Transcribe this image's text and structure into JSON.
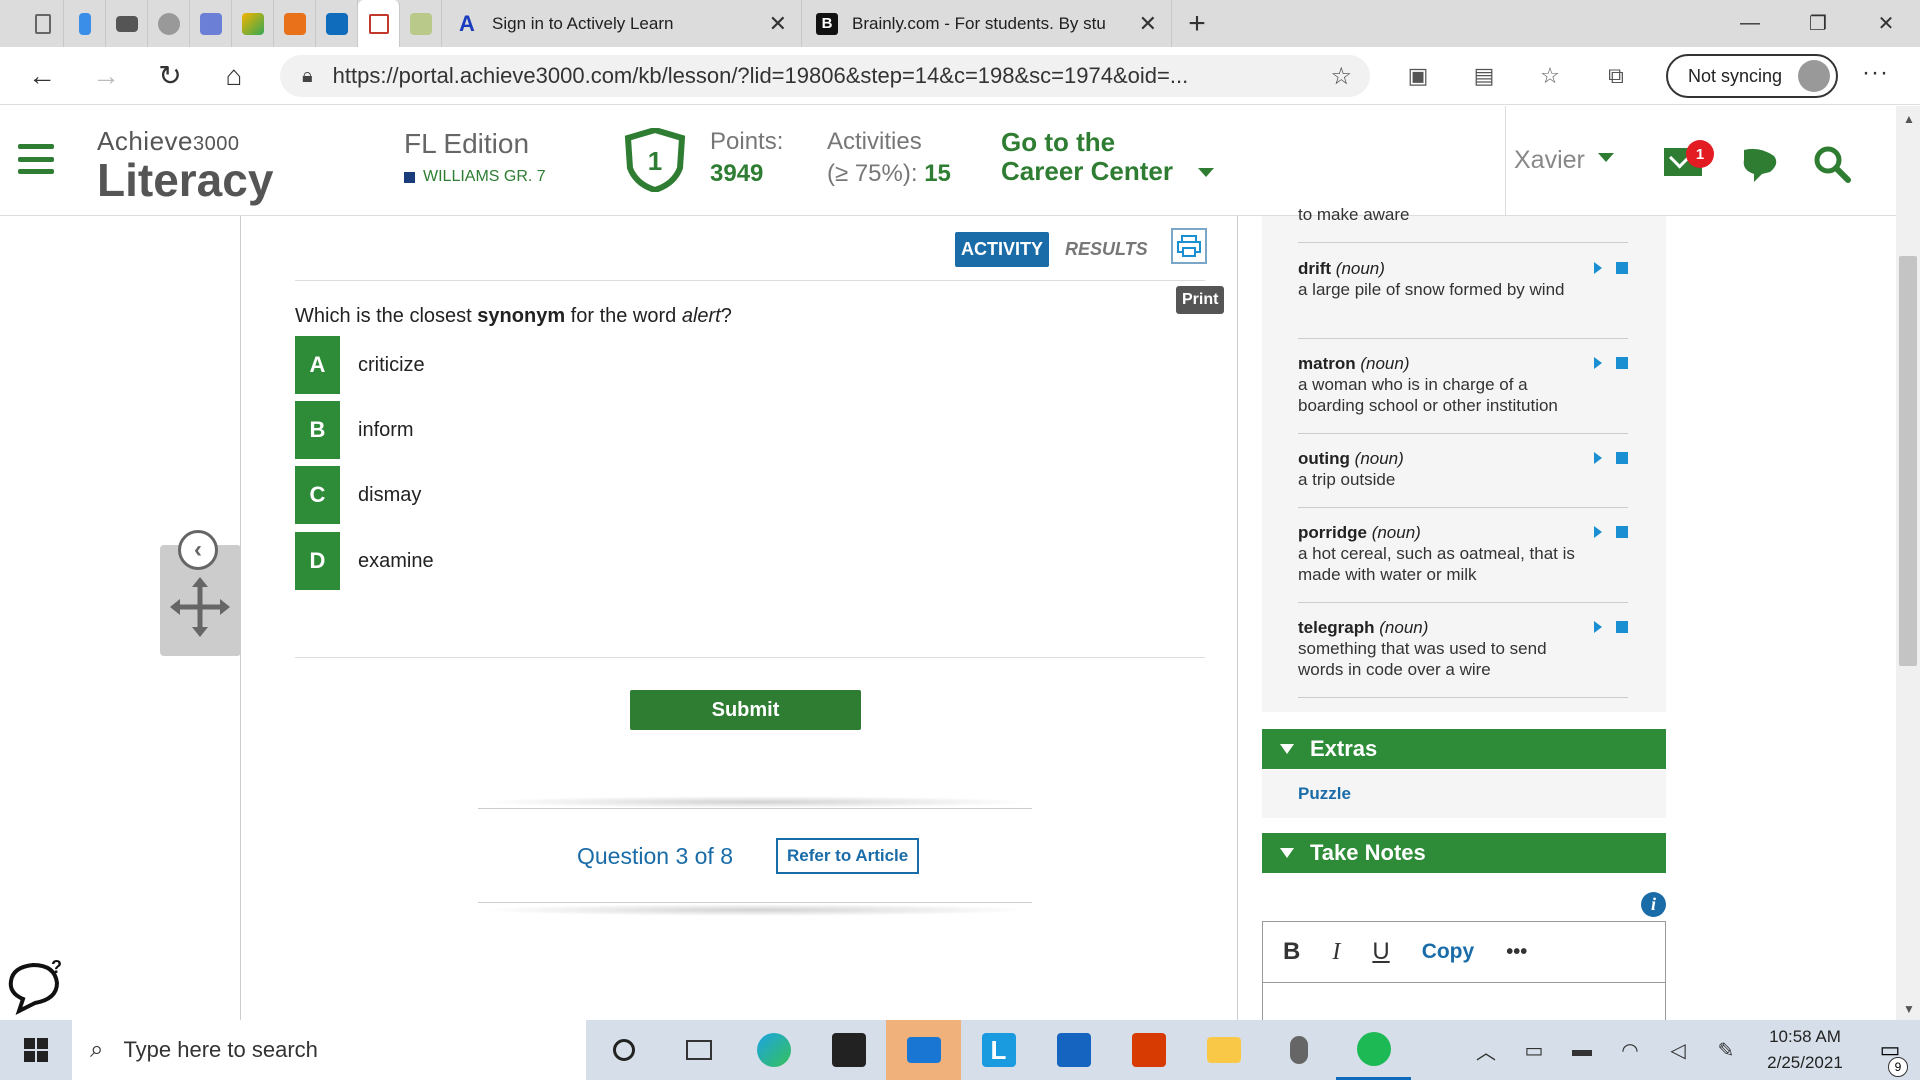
{
  "browser": {
    "tabs": [
      {
        "title": "Sign in to Actively Learn",
        "icon": "actively-learn-icon"
      },
      {
        "title": "Brainly.com - For students. By stu",
        "icon": "brainly-icon"
      }
    ],
    "address": {
      "url": "https://portal.achieve3000.com/kb/lesson/?lid=19806&step=14&c=198&sc=1974&oid=..."
    },
    "sync_label": "Not syncing"
  },
  "header": {
    "logo_line1": "Achieve",
    "logo_line1_num": "3000",
    "logo_line2": "Literacy",
    "edition": "FL Edition",
    "class_name": "WILLIAMS GR. 7",
    "shield_number": "1",
    "points_label": "Points:",
    "points_value": "3949",
    "activities_label": "Activities",
    "activities_sub": "(≥ 75%): ",
    "activities_value": "15",
    "career_line1": "Go to the",
    "career_line2": "Career Center",
    "user": "Xavier",
    "mail_badge": "1"
  },
  "activity": {
    "tab_activity": "ACTIVITY",
    "tab_results": "RESULTS",
    "print_tooltip": "Print",
    "question_prefix": "Which is the closest ",
    "question_bold": "synonym",
    "question_mid": " for the word ",
    "question_italic": "alert",
    "question_suffix": "?",
    "answers": [
      {
        "letter": "A",
        "text": "criticize"
      },
      {
        "letter": "B",
        "text": "inform"
      },
      {
        "letter": "C",
        "text": "dismay"
      },
      {
        "letter": "D",
        "text": "examine"
      }
    ],
    "submit": "Submit",
    "question_count": "Question 3 of 8",
    "refer": "Refer to Article"
  },
  "vocabulary": {
    "partial_text": "to make aware",
    "items": [
      {
        "word": "drift",
        "pos": "(noun)",
        "def": "a large pile of snow formed by wind"
      },
      {
        "word": "matron",
        "pos": "(noun)",
        "def": "a woman who is in charge of a boarding school or other institution"
      },
      {
        "word": "outing",
        "pos": "(noun)",
        "def": "a trip outside"
      },
      {
        "word": "porridge",
        "pos": "(noun)",
        "def": "a hot cereal, such as oatmeal, that is made with water or milk"
      },
      {
        "word": "telegraph",
        "pos": "(noun)",
        "def": "something that was used to send words in code over a wire"
      }
    ]
  },
  "extras": {
    "title": "Extras",
    "puzzle": "Puzzle"
  },
  "notes": {
    "title": "Take Notes",
    "bold": "B",
    "italic": "I",
    "underline": "U",
    "copy": "Copy",
    "more": "•••"
  },
  "taskbar": {
    "search_placeholder": "Type here to search",
    "time": "10:58 AM",
    "date": "2/25/2021",
    "notifications": "9"
  },
  "colors": {
    "brand_green": "#2e7d32",
    "answer_green": "#2e8b38",
    "link_blue": "#1a6ca8",
    "badge_red": "#e31b23"
  }
}
